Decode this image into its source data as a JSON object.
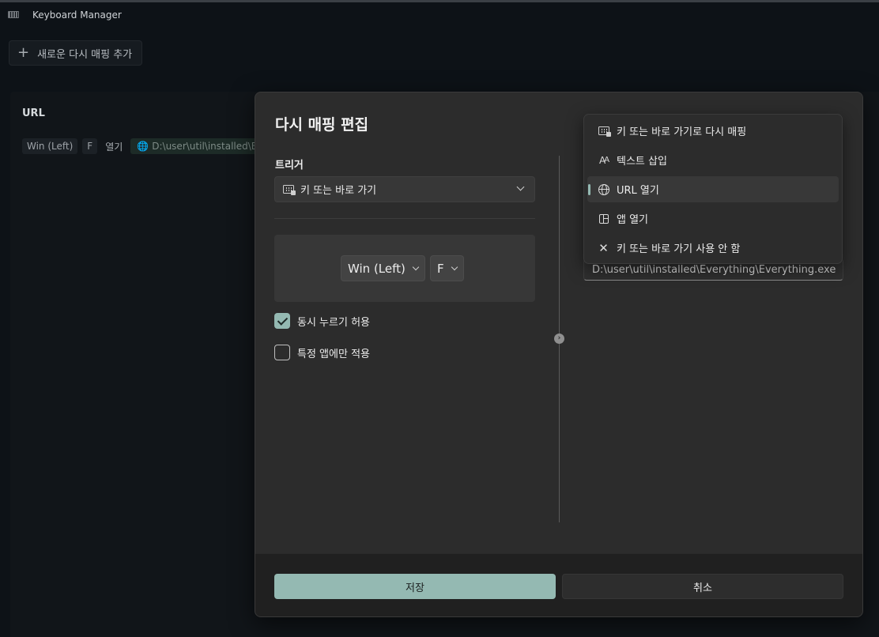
{
  "window": {
    "title": "Keyboard Manager"
  },
  "toolbar": {
    "add_remapping_label": "새로운 다시 매핑 추가",
    "add_icon": "plus-icon"
  },
  "background_list": {
    "section_title": "URL",
    "row": {
      "key1": "Win (Left)",
      "key2": "F",
      "action": "열기",
      "url": "D:\\user\\util\\installed\\Every"
    }
  },
  "dialog": {
    "title": "다시 매핑 편집",
    "trigger_label": "트리거",
    "trigger_select": {
      "value": "키 또는 바로 가기",
      "icon": "keyboard-icon"
    },
    "keys": [
      "Win (Left)",
      "F"
    ],
    "options": [
      {
        "label": "동시 누르기 허용",
        "checked": true
      },
      {
        "label": "특정 앱에만 적용",
        "checked": false
      }
    ],
    "arrow_icon": "arrow-right-icon",
    "action_path": "D:\\user\\util\\installed\\Everything\\Everything.exe",
    "save_label": "저장",
    "cancel_label": "취소"
  },
  "action_menu": {
    "items": [
      {
        "label": "키 또는 바로 가기로 다시 매핑",
        "icon": "keyboard-icon",
        "selected": false
      },
      {
        "label": "텍스트 삽입",
        "icon": "text-icon",
        "selected": false
      },
      {
        "label": "URL 열기",
        "icon": "globe-icon",
        "selected": true
      },
      {
        "label": "앱 열기",
        "icon": "app-icon",
        "selected": false
      },
      {
        "label": "키 또는 바로 가기 사용 안 함",
        "icon": "close-icon",
        "selected": false
      }
    ]
  },
  "colors": {
    "accent": "#94b9b2",
    "dialog_bg": "#2c2c2c",
    "app_bg": "#0d1217"
  }
}
